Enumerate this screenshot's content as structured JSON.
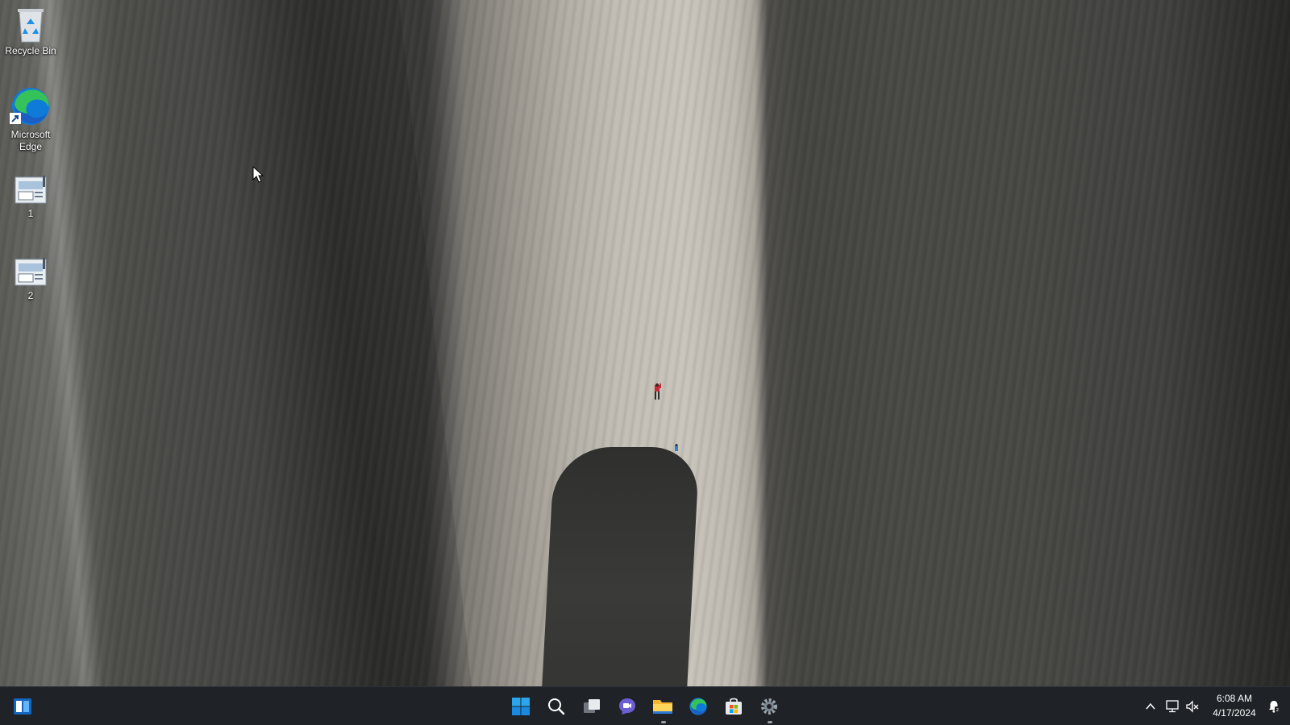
{
  "desktop": {
    "icons": [
      {
        "label": "Recycle Bin",
        "icon": "recycle-bin-icon"
      },
      {
        "label": "Microsoft Edge",
        "icon": "edge-icon"
      },
      {
        "label": "1",
        "icon": "image-file-icon"
      },
      {
        "label": "2",
        "icon": "image-file-icon"
      }
    ]
  },
  "taskbar": {
    "pinned": [
      {
        "name": "Start",
        "icon": "windows-start-icon"
      },
      {
        "name": "Search",
        "icon": "search-icon"
      },
      {
        "name": "Task View",
        "icon": "task-view-icon"
      },
      {
        "name": "Chat",
        "icon": "chat-icon"
      },
      {
        "name": "File Explorer",
        "icon": "folder-icon"
      },
      {
        "name": "Microsoft Edge",
        "icon": "edge-icon"
      },
      {
        "name": "Microsoft Store",
        "icon": "store-icon"
      },
      {
        "name": "Settings",
        "icon": "gear-icon"
      }
    ],
    "widgets_icon": "widgets-icon",
    "tray": {
      "chevron_icon": "chevron-up-icon",
      "network_icon": "network-icon",
      "volume_icon": "volume-muted-icon",
      "notification_icon": "notification-icon"
    },
    "clock": {
      "time": "6:08 AM",
      "date": "4/17/2024"
    }
  },
  "colors": {
    "taskbar_bg": "#1f2226",
    "accent_blue": "#0078d4",
    "text": "#ffffff"
  }
}
